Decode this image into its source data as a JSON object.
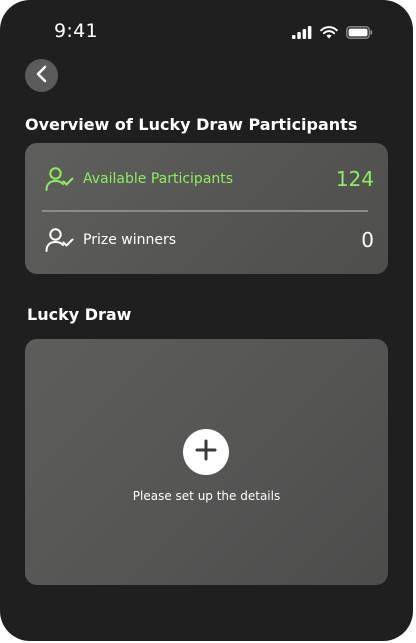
{
  "status_bar": {
    "time": "9:41",
    "icons": [
      "signal-icon",
      "wifi-icon",
      "battery-icon"
    ]
  },
  "header": {
    "back_icon": "chevron-left-icon"
  },
  "overview": {
    "title": "Overview of Lucky Draw Participants",
    "available": {
      "label": "Available Participants",
      "value": "124",
      "icon": "user-check-icon",
      "color": "#8bf05d"
    },
    "winners": {
      "label": "Prize winners",
      "value": "0",
      "icon": "user-check-icon",
      "color": "#ffffff"
    }
  },
  "lucky_draw": {
    "title": "Lucky Draw",
    "add_icon": "plus-icon",
    "hint": "Please set up the details"
  },
  "colors": {
    "background": "#1f1f1f",
    "card": "#565654",
    "accent": "#8bf05d"
  }
}
